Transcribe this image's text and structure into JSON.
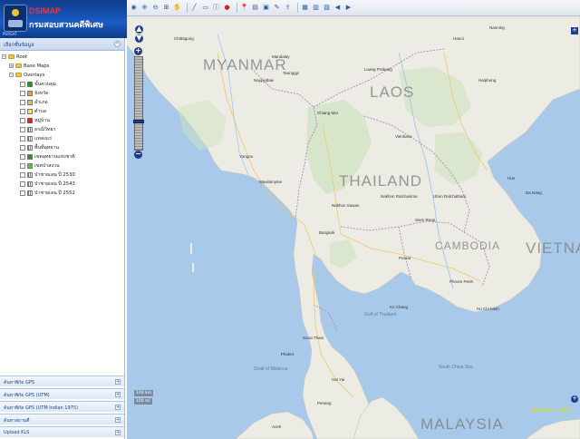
{
  "header": {
    "brand": "DSIMAP",
    "subtitle": "กรมสอบสวนคดีพิเศษ",
    "tagline": "PURSAT"
  },
  "sidebar": {
    "panel_title": "เลือกชั้นข้อมูล",
    "tree": {
      "root": "Root",
      "base_maps": "Base Maps",
      "overlays": "Overlays",
      "layers": [
        {
          "label": "ขั้นควบคุม",
          "icon": "flag-icon",
          "color": "#3a8a3a"
        },
        {
          "label": "จังหวัด",
          "icon": "swatch",
          "color": "#e89b3a"
        },
        {
          "label": "อำเภอ",
          "icon": "swatch",
          "color": "#e3c24a"
        },
        {
          "label": "ตำบล",
          "icon": "swatch",
          "color": "#f3e36a"
        },
        {
          "label": "หมู่บ้าน",
          "icon": "house-icon",
          "color": "#b33a2a"
        },
        {
          "label": "ธรณีวิทยา",
          "icon": "grid-icon",
          "color": "#6b6b6b"
        },
        {
          "label": "แหล่งแร่",
          "icon": "grid-icon",
          "color": "#6b6b6b"
        },
        {
          "label": "พื้นที่อุทยาน",
          "icon": "grid-icon",
          "color": "#6b6b6b"
        },
        {
          "label": "เขตอุทยานแห่งชาติ",
          "icon": "swatch",
          "color": "#3f7f3f"
        },
        {
          "label": "เขตป่าสงวน",
          "icon": "swatch",
          "color": "#6bbf3f"
        },
        {
          "label": "ป่าชายเลน ปี 2530",
          "icon": "grid-icon",
          "color": "#6b6b6b"
        },
        {
          "label": "ป่าชายเลน ปี 2543",
          "icon": "grid-icon",
          "color": "#6b6b6b"
        },
        {
          "label": "ป่าชายเลน ปี 2552",
          "icon": "grid-icon",
          "color": "#6b6b6b"
        }
      ]
    },
    "accordions": [
      "ค้นหาพิกัด GPS",
      "ค้นหาพิกัด GPS (UTM)",
      "ค้นหาพิกัด GPS (UTM Indian 1975)",
      "ค้นหาสถานที่",
      "Upload KLS"
    ]
  },
  "map": {
    "countries": [
      "MYANMAR",
      "LAOS",
      "THAILAND",
      "VIETNA",
      "CAMBODIA",
      "MALAYSIA"
    ],
    "cities": {
      "chittagong": "Chittagong",
      "mandalay": "Mandalay",
      "naypyidaw": "Naypyidaw",
      "taunggyi": "Taunggyi",
      "hanoi": "Hanoi",
      "haiphong": "Haiphong",
      "nanning": "Nanning",
      "luang": "Luang Prabang",
      "vientiane": "Vientiane",
      "chiangmai": "Chiang Mai",
      "yangon": "Yangon",
      "mawlamyine": "Mawlamyine",
      "nakhon": "Nakhon Sawan",
      "bangkok": "Bangkok",
      "phnompenh": "Phnom Penh",
      "pursat": "Pursat",
      "hue": "Hue",
      "danang": "Da Nang",
      "hcm": "Ho Chi Minh",
      "surat": "Surat Thani",
      "hatyai": "Hat Yai",
      "penang": "Penang",
      "aceh": "Aceh",
      "phuket": "Phuket",
      "kochang": "Ko Chang",
      "siemreap": "Siem Reap",
      "ubon": "Ubon Ratchathani",
      "korat": "Nakhon Ratchasima"
    },
    "seas": {
      "south_china_sea": "South China Sea",
      "gulf_thailand": "Gulf of Thailand",
      "malacca": "Strait of Malacca"
    },
    "scale_km": "100 km",
    "scale_mi": "100 mi",
    "coords": "101.90275, 1.38827"
  }
}
